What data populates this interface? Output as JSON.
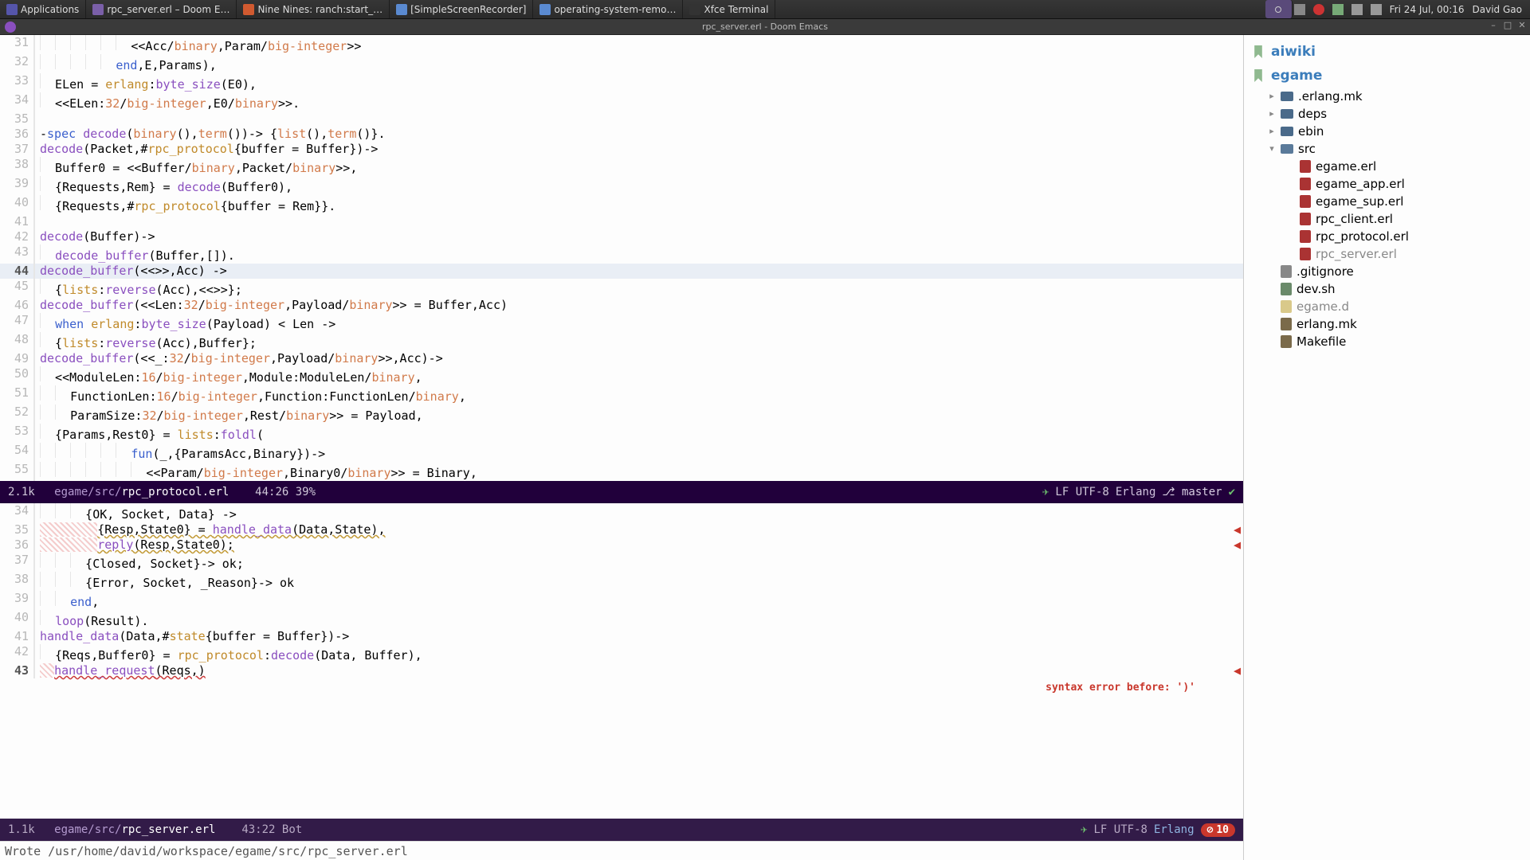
{
  "taskbar": {
    "apps_label": "Applications",
    "items": [
      {
        "label": "rpc_server.erl – Doom E…",
        "icon": "#7a5fa8"
      },
      {
        "label": "Nine Nines: ranch:start_…",
        "icon": "#d15a30"
      },
      {
        "label": "[SimpleScreenRecorder]",
        "icon": "#5a8ad1"
      },
      {
        "label": "operating-system-remo…",
        "icon": "#5a8ad1"
      },
      {
        "label": "Xfce Terminal",
        "icon": "#333"
      }
    ],
    "clock": "Fri 24 Jul, 00:16",
    "user": "David Gao"
  },
  "frame": {
    "title": "rpc_server.erl - Doom Emacs"
  },
  "buf1": {
    "path": "egame/src/rpc_protocol.erl",
    "size": "2.1k",
    "pos": "44:26 39%",
    "encoding": "LF UTF-8",
    "mode": "Erlang",
    "branch": "master",
    "lines": [
      {
        "n": 31,
        "pre": "            ",
        "code": "<<Acc/binary,Param/big-integer>>"
      },
      {
        "n": 32,
        "pre": "          ",
        "code": "end,E,Params),"
      },
      {
        "n": 33,
        "pre": "  ",
        "code": "ELen = erlang:byte_size(E0),"
      },
      {
        "n": 34,
        "pre": "  ",
        "code": "<<ELen:32/big-integer,E0/binary>>."
      },
      {
        "n": 35,
        "pre": "",
        "code": ""
      },
      {
        "n": 36,
        "pre": "",
        "code": "-spec decode(binary(),term())-> {list(),term()}."
      },
      {
        "n": 37,
        "pre": "",
        "code": "decode(Packet,#rpc_protocol{buffer = Buffer})->"
      },
      {
        "n": 38,
        "pre": "  ",
        "code": "Buffer0 = <<Buffer/binary,Packet/binary>>,"
      },
      {
        "n": 39,
        "pre": "  ",
        "code": "{Requests,Rem} = decode(Buffer0),"
      },
      {
        "n": 40,
        "pre": "  ",
        "code": "{Requests,#rpc_protocol{buffer = Rem}}."
      },
      {
        "n": 41,
        "pre": "",
        "code": ""
      },
      {
        "n": 42,
        "pre": "",
        "code": "decode(Buffer)->"
      },
      {
        "n": 43,
        "pre": "  ",
        "code": "decode_buffer(Buffer,[])."
      },
      {
        "n": 44,
        "pre": "",
        "code": "decode_buffer(<<>>,Acc) ->",
        "current": true
      },
      {
        "n": 45,
        "pre": "  ",
        "code": "{lists:reverse(Acc),<<>>};"
      },
      {
        "n": 46,
        "pre": "",
        "code": "decode_buffer(<<Len:32/big-integer,Payload/binary>> = Buffer,Acc)"
      },
      {
        "n": 47,
        "pre": "  ",
        "code": "when erlang:byte_size(Payload) < Len ->"
      },
      {
        "n": 48,
        "pre": "  ",
        "code": "{lists:reverse(Acc),Buffer};"
      },
      {
        "n": 49,
        "pre": "",
        "code": "decode_buffer(<<_:32/big-integer,Payload/binary>>,Acc)->"
      },
      {
        "n": 50,
        "pre": "  ",
        "code": "<<ModuleLen:16/big-integer,Module:ModuleLen/binary,"
      },
      {
        "n": 51,
        "pre": "    ",
        "code": "FunctionLen:16/big-integer,Function:FunctionLen/binary,"
      },
      {
        "n": 52,
        "pre": "    ",
        "code": "ParamSize:32/big-integer,Rest/binary>> = Payload,"
      },
      {
        "n": 53,
        "pre": "  ",
        "code": "{Params,Rest0} = lists:foldl("
      },
      {
        "n": 54,
        "pre": "            ",
        "code": "fun(_,{ParamsAcc,Binary})->"
      },
      {
        "n": 55,
        "pre": "              ",
        "code": "<<Param/big-integer,Binary0/binary>> = Binary,"
      }
    ]
  },
  "buf2": {
    "path": "egame/src/rpc_server.erl",
    "size": "1.1k",
    "pos": "43:22 Bot",
    "encoding": "LF UTF-8",
    "mode": "Erlang",
    "err_badge": "10",
    "error_msg": "syntax error before: ')'",
    "lines": [
      {
        "n": 34,
        "pre": "      ",
        "code": "{OK, Socket, Data} ->"
      },
      {
        "n": 35,
        "pre": "        ",
        "code": "{Resp,State0} = handle_data(Data,State),",
        "warn": true,
        "mark": true
      },
      {
        "n": 36,
        "pre": "        ",
        "code": "reply(Resp,State0);",
        "warn": true,
        "mark": true
      },
      {
        "n": 37,
        "pre": "      ",
        "code": "{Closed, Socket}-> ok;"
      },
      {
        "n": 38,
        "pre": "      ",
        "code": "{Error, Socket, _Reason}-> ok"
      },
      {
        "n": 39,
        "pre": "    ",
        "code": "end,"
      },
      {
        "n": 40,
        "pre": "  ",
        "code": "loop(Result)."
      },
      {
        "n": 41,
        "pre": "",
        "code": "handle_data(Data,#state{buffer = Buffer})->"
      },
      {
        "n": 42,
        "pre": "  ",
        "code": "{Reqs,Buffer0} = rpc_protocol:decode(Data, Buffer),"
      },
      {
        "n": 43,
        "pre": "  ",
        "code": "handle_request(Reqs,)",
        "err": true,
        "cursor": true,
        "mark": true
      }
    ]
  },
  "tree": {
    "roots": [
      {
        "label": "aiwiki"
      },
      {
        "label": "egame",
        "expanded": true,
        "children": [
          {
            "type": "dir",
            "label": ".erlang.mk"
          },
          {
            "type": "dir",
            "label": "deps"
          },
          {
            "type": "dir",
            "label": "ebin"
          },
          {
            "type": "dir",
            "label": "src",
            "expanded": true,
            "children": [
              {
                "type": "erl",
                "label": "egame.erl"
              },
              {
                "type": "erl",
                "label": "egame_app.erl"
              },
              {
                "type": "erl",
                "label": "egame_sup.erl"
              },
              {
                "type": "erl",
                "label": "rpc_client.erl"
              },
              {
                "type": "erl",
                "label": "rpc_protocol.erl"
              },
              {
                "type": "erl",
                "label": "rpc_server.erl",
                "muted": true
              }
            ]
          },
          {
            "type": "ign",
            "label": ".gitignore"
          },
          {
            "type": "sh",
            "label": "dev.sh"
          },
          {
            "type": "file",
            "label": "egame.d",
            "muted": true
          },
          {
            "type": "mk",
            "label": "erlang.mk"
          },
          {
            "type": "mk",
            "label": "Makefile"
          }
        ]
      }
    ]
  },
  "minibuffer": "Wrote /usr/home/david/workspace/egame/src/rpc_server.erl"
}
